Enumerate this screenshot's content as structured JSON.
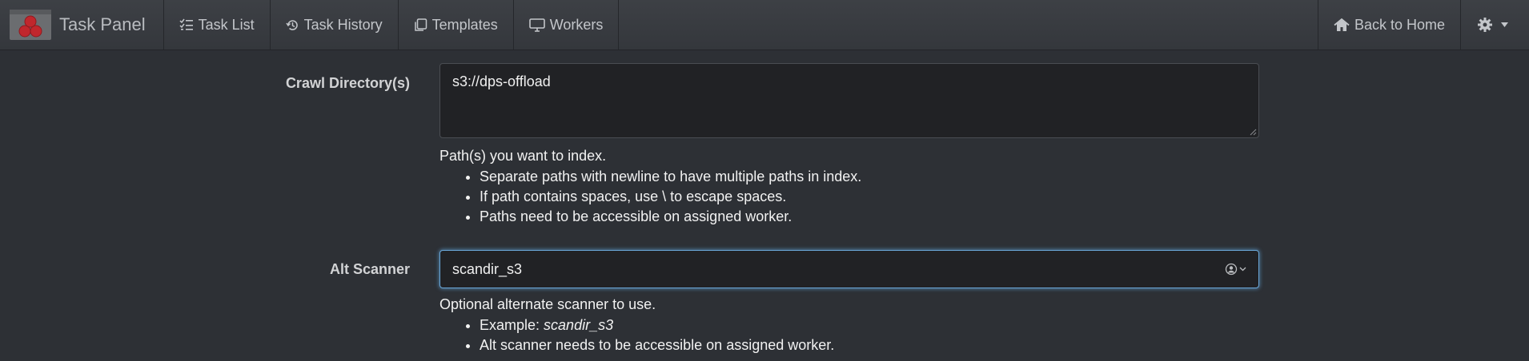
{
  "navbar": {
    "brand_title": "Task Panel",
    "items": [
      {
        "label": "Task List",
        "icon": "list-check-icon"
      },
      {
        "label": "Task History",
        "icon": "history-icon"
      },
      {
        "label": "Templates",
        "icon": "copy-icon"
      },
      {
        "label": "Workers",
        "icon": "desktop-icon"
      }
    ],
    "back_home": "Back to Home",
    "settings_icon": "gear-icon"
  },
  "form": {
    "crawl": {
      "label": "Crawl Directory(s)",
      "value": "s3://dps-offload",
      "help_lead": "Path(s) you want to index.",
      "help_items": [
        "Separate paths with newline to have multiple paths in index.",
        "If path contains spaces, use \\ to escape spaces.",
        "Paths need to be accessible on assigned worker."
      ]
    },
    "alt_scanner": {
      "label": "Alt Scanner",
      "value": "scandir_s3",
      "help_lead": "Optional alternate scanner to use.",
      "example_prefix": "Example: ",
      "example_value": "scandir_s3",
      "help_item2": "Alt scanner needs to be accessible on assigned worker."
    }
  },
  "colors": {
    "background": "#2d3035",
    "navbar": "#3a3d42",
    "focus": "#6aa7d8",
    "brand_red": "#c0272d"
  }
}
